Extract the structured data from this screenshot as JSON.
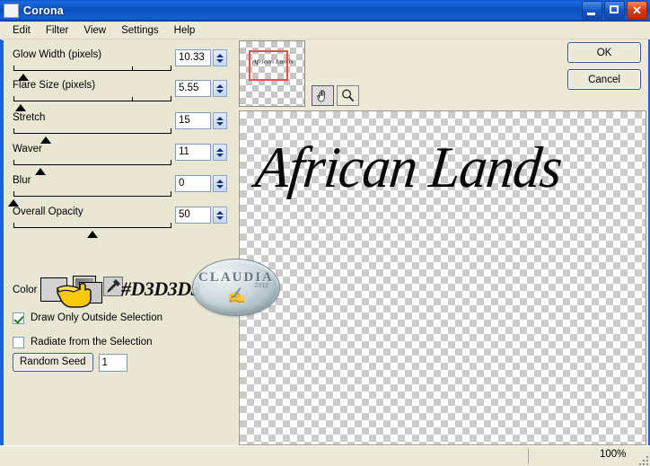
{
  "window": {
    "title": "Corona",
    "icon": "app-icon",
    "controls": {
      "minimize": "–",
      "maximize": "□",
      "close": "✕"
    }
  },
  "menubar": {
    "items": [
      {
        "label": "Edit"
      },
      {
        "label": "Filter"
      },
      {
        "label": "View"
      },
      {
        "label": "Settings"
      },
      {
        "label": "Help"
      }
    ]
  },
  "settings": {
    "sliders": [
      {
        "label": "Glow Width (pixels)",
        "value": "10.33",
        "thumb_pct": 6
      },
      {
        "label": "Flare Size (pixels)",
        "value": "5.55",
        "thumb_pct": 3
      },
      {
        "label": "Stretch",
        "value": "15",
        "thumb_pct": 17
      },
      {
        "label": "Waver",
        "value": "11",
        "thumb_pct": 13
      },
      {
        "label": "Blur",
        "value": "0",
        "thumb_pct": 0
      },
      {
        "label": "Overall Opacity",
        "value": "50",
        "thumb_pct": 50
      }
    ],
    "color": {
      "label": "Color",
      "swatch_hex": "#D3D3D3",
      "annotation": "#D3D3D3",
      "eyedropper_icon": "eyedropper-icon",
      "cursor_icon": "pointing-hand-cursor"
    },
    "checkboxes": [
      {
        "label": "Draw Only Outside Selection",
        "checked": true
      },
      {
        "label": "Radiate from the Selection",
        "checked": false
      }
    ],
    "random_seed": {
      "button_label": "Random Seed",
      "value": "1"
    }
  },
  "preview": {
    "navigator": {
      "name": "navigator-thumbnail",
      "mini_text": "African Lands"
    },
    "tools": [
      {
        "name": "pan-tool",
        "icon": "hand-icon",
        "active": true
      },
      {
        "name": "zoom-tool",
        "icon": "magnifier-icon",
        "active": false
      }
    ],
    "buttons": {
      "ok": "OK",
      "cancel": "Cancel"
    },
    "canvas_text": "African Lands",
    "watermark": {
      "text": "CLAUDIA",
      "sub": "2012",
      "mark": "✍"
    }
  },
  "statusbar": {
    "zoom": "100%"
  }
}
